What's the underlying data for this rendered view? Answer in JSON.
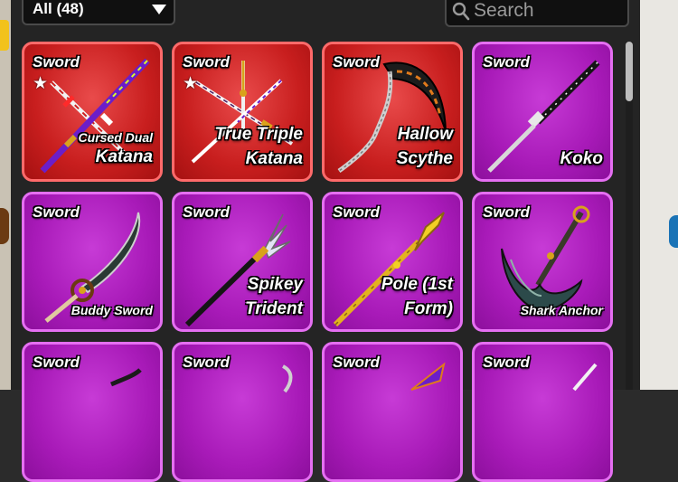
{
  "filter": {
    "selected": "All (48)"
  },
  "search": {
    "placeholder": "Search"
  },
  "items": [
    {
      "type": "Sword",
      "line1": "Cursed Dual",
      "line2": "Katana",
      "starred": true,
      "rarity": "red"
    },
    {
      "type": "Sword",
      "line1": "True Triple",
      "line2": "Katana",
      "starred": true,
      "rarity": "red"
    },
    {
      "type": "Sword",
      "line1": "Hallow",
      "line2": "Scythe",
      "starred": false,
      "rarity": "red"
    },
    {
      "type": "Sword",
      "line1": "",
      "line2": "Koko",
      "starred": false,
      "rarity": "purple"
    },
    {
      "type": "Sword",
      "line1": "",
      "line2": "Buddy Sword",
      "starred": false,
      "rarity": "purple"
    },
    {
      "type": "Sword",
      "line1": "Spikey",
      "line2": "Trident",
      "starred": false,
      "rarity": "purple"
    },
    {
      "type": "Sword",
      "line1": "Pole (1st",
      "line2": "Form)",
      "starred": false,
      "rarity": "purple"
    },
    {
      "type": "Sword",
      "line1": "",
      "line2": "Shark Anchor",
      "starred": false,
      "rarity": "purple"
    },
    {
      "type": "Sword",
      "rarity": "purple"
    },
    {
      "type": "Sword",
      "rarity": "purple"
    },
    {
      "type": "Sword",
      "rarity": "purple"
    },
    {
      "type": "Sword",
      "rarity": "purple"
    }
  ],
  "colors": {
    "legendary": "#c81e1e",
    "mythical": "#a81ab8"
  },
  "icons": {
    "search": "search-icon",
    "dropdown": "chevron-down-icon",
    "favorite": "star-icon"
  }
}
